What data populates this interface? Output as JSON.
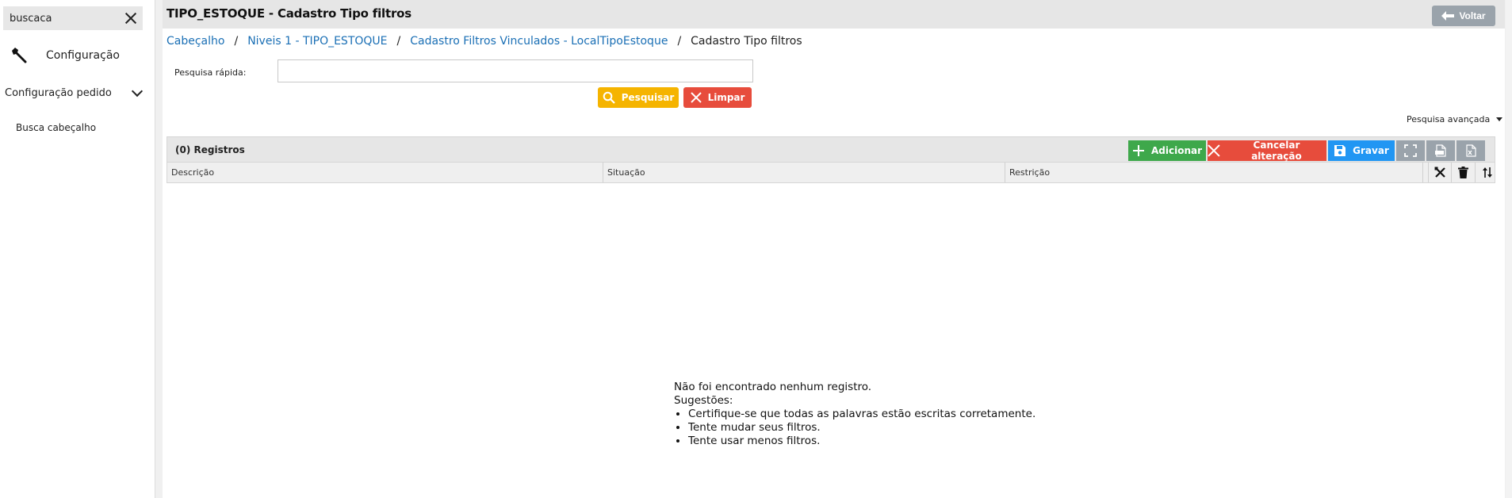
{
  "sidebar": {
    "search_value": "buscaca",
    "config_label": "Configuração",
    "section_label": "Configuração pedido",
    "item_label": "Busca cabeçalho"
  },
  "header": {
    "title": "TIPO_ESTOQUE - Cadastro Tipo filtros",
    "back_label": "Voltar"
  },
  "breadcrumb": {
    "items": [
      "Cabeçalho",
      "Niveis 1 - TIPO_ESTOQUE",
      "Cadastro Filtros Vinculados - LocalTipoEstoque"
    ],
    "current": "Cadastro Tipo filtros",
    "separator": "/"
  },
  "quick_search": {
    "label": "Pesquisa rápida:",
    "value": "",
    "search_label": "Pesquisar",
    "clear_label": "Limpar"
  },
  "advanced_search_label": "Pesquisa avançada",
  "grid": {
    "count_label": "(0) Registros",
    "add_label": "Adicionar",
    "cancel_label": "Cancelar alteração",
    "save_label": "Gravar",
    "columns": [
      "Descrição",
      "Situação",
      "Restrição"
    ]
  },
  "empty_state": {
    "line1": "Não foi encontrado nenhum registro.",
    "line2": "Sugestões:",
    "tips": [
      "Certifique-se que todas as palavras estão escritas corretamente.",
      "Tente mudar seus filtros.",
      "Tente usar menos filtros."
    ]
  },
  "colors": {
    "link": "#1a6fb5",
    "yellow": "#f5b400",
    "red": "#e74c3c",
    "green": "#3ea84b",
    "blue": "#2196f3",
    "gray": "#9aa3ab"
  }
}
